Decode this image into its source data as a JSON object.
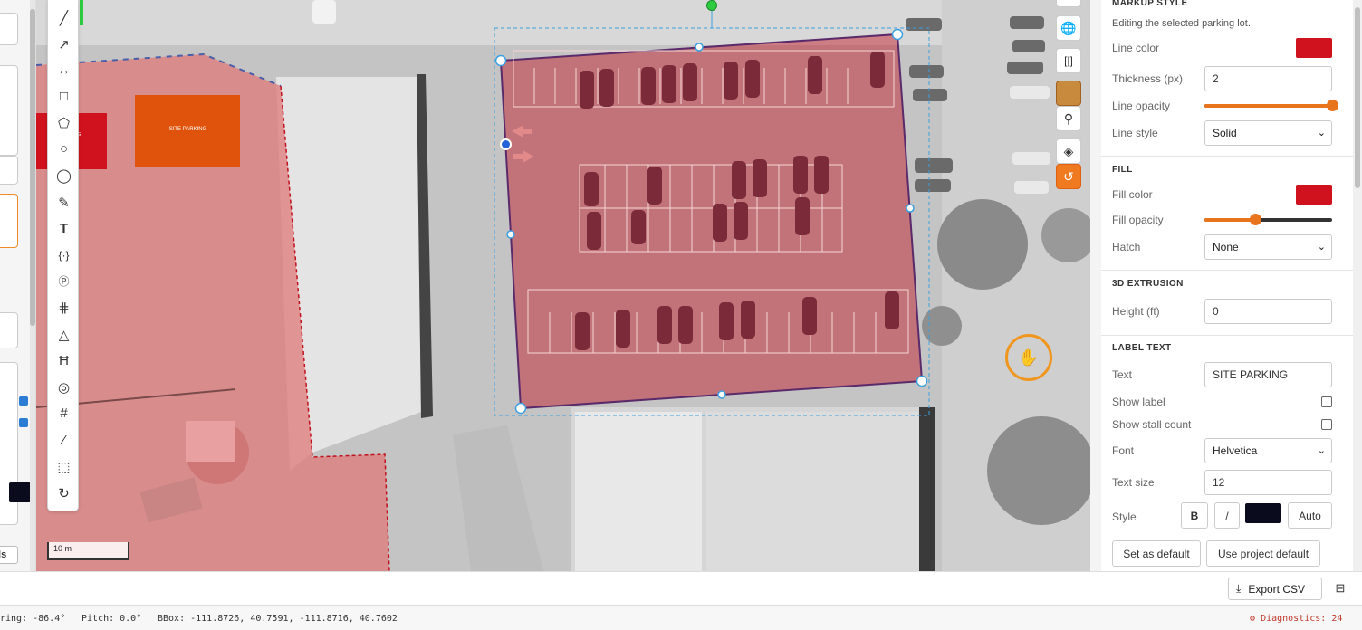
{
  "left_panel": {
    "button_label": "ils"
  },
  "map": {
    "site_label": "SITE PARKING",
    "scale_label": "10 m"
  },
  "toolbar": {
    "tools": [
      "line",
      "curve",
      "measure",
      "rectangle",
      "polygon",
      "circle",
      "ellipse",
      "pencil",
      "text",
      "bracket",
      "parking",
      "stalls",
      "path",
      "ladder",
      "target",
      "grid",
      "brush",
      "select-area",
      "rotate"
    ]
  },
  "controls": [
    "globe",
    "brackets",
    "satellite",
    "pin",
    "layers",
    "orange-mode"
  ],
  "panel": {
    "markup_title": "MARKUP STYLE",
    "markup_subtitle": "Editing the selected parking lot.",
    "line_color_label": "Line color",
    "line_color": "#d0121e",
    "thickness_label": "Thickness (px)",
    "thickness_value": "2",
    "line_opacity_label": "Line opacity",
    "line_opacity": 1.0,
    "line_style_label": "Line style",
    "line_style_value": "Solid",
    "fill_title": "FILL",
    "fill_color_label": "Fill color",
    "fill_color": "#d0121e",
    "fill_opacity_label": "Fill opacity",
    "fill_opacity": 0.4,
    "hatch_label": "Hatch",
    "hatch_value": "None",
    "extrusion_title": "3D EXTRUSION",
    "height_label": "Height (ft)",
    "height_value": "0",
    "label_text_title": "LABEL TEXT",
    "text_label": "Text",
    "text_value": "SITE PARKING",
    "show_label_label": "Show label",
    "show_stall_count_label": "Show stall count",
    "font_label": "Font",
    "font_value": "Helvetica",
    "text_size_label": "Text size",
    "text_size_value": "12",
    "style_label": "Style",
    "bold_label": "B",
    "italic_label": "/",
    "text_color": "#0b0b1e",
    "auto_label": "Auto",
    "set_default_label": "Set as default",
    "project_default_label": "Use project default"
  },
  "footer": {
    "export_label": "Export CSV"
  },
  "status": {
    "bearing": "ring: -86.4°",
    "pitch": "Pitch: 0.0°",
    "bbox": "BBox: -111.8726, 40.7591, -111.8716, 40.7602",
    "diagnostics": "Diagnostics: 24"
  }
}
